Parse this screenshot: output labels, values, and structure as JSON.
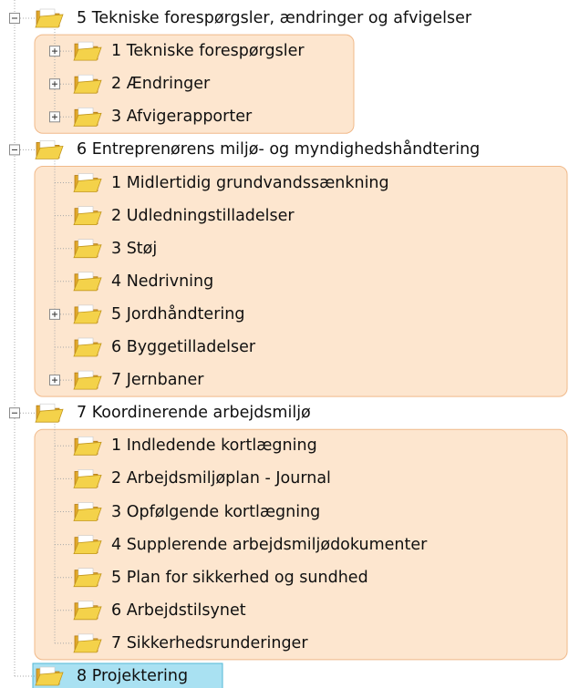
{
  "tree": {
    "groups": [
      {
        "label": "5 Tekniske forespørgsler, ændringer og afvigelser",
        "expanded": true,
        "children": [
          {
            "label": "1 Tekniske forespørgsler",
            "has_children": true
          },
          {
            "label": "2 Ændringer",
            "has_children": true
          },
          {
            "label": "3 Afvigerapporter",
            "has_children": true
          }
        ]
      },
      {
        "label": "6 Entreprenørens miljø- og myndighedshåndtering",
        "expanded": true,
        "children": [
          {
            "label": "1 Midlertidig grundvandssænkning",
            "has_children": false
          },
          {
            "label": "2 Udledningstilladelser",
            "has_children": false
          },
          {
            "label": "3 Støj",
            "has_children": false
          },
          {
            "label": "4 Nedrivning",
            "has_children": false
          },
          {
            "label": "5 Jordhåndtering",
            "has_children": true
          },
          {
            "label": "6 Byggetilladelser",
            "has_children": false
          },
          {
            "label": "7 Jernbaner",
            "has_children": true
          }
        ]
      },
      {
        "label": "7 Koordinerende arbejdsmiljø",
        "expanded": true,
        "children": [
          {
            "label": "1 Indledende kortlægning",
            "has_children": false
          },
          {
            "label": "2 Arbejdsmiljøplan - Journal",
            "has_children": false
          },
          {
            "label": "3 Opfølgende kortlægning",
            "has_children": false
          },
          {
            "label": "4 Supplerende arbejdsmiljødokumenter",
            "has_children": false
          },
          {
            "label": "5 Plan for sikkerhed og sundhed",
            "has_children": false
          },
          {
            "label": "6 Arbejdstilsynet",
            "has_children": false
          },
          {
            "label": "7 Sikkerhedsrunderinger",
            "has_children": false
          }
        ]
      }
    ],
    "selected": {
      "label": "8 Projektering"
    }
  },
  "colors": {
    "highlight_fill": "#fde6cf",
    "highlight_border": "#f0b98a",
    "selection_fill": "#a9e1f2",
    "selection_border": "#53b8d6",
    "folder_front": "#f4d24a",
    "folder_back": "#e0a72a",
    "tree_line": "#a8a8a8"
  },
  "icons": {
    "folder": "open-folder-icon",
    "expand": "expand-plus-icon",
    "collapse": "collapse-minus-icon"
  }
}
